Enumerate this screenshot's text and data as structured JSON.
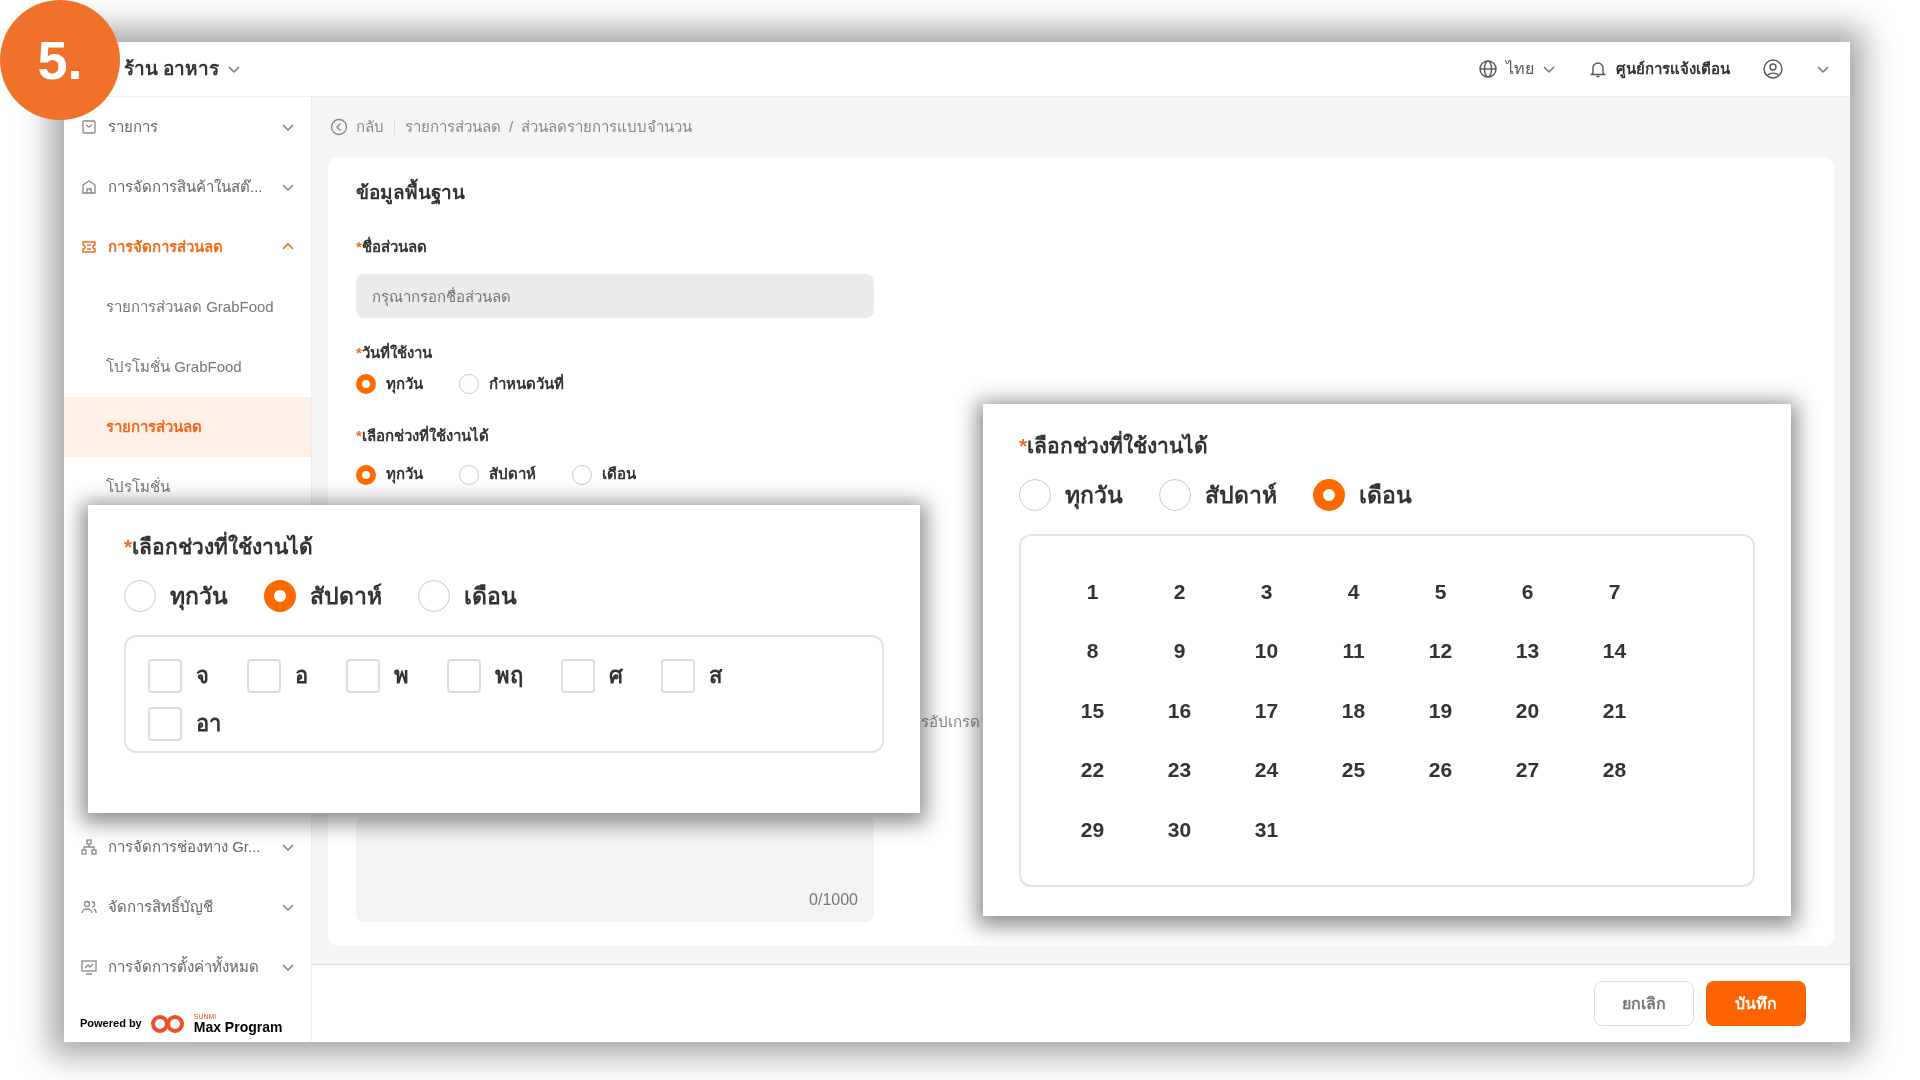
{
  "step_badge": "5.",
  "header": {
    "store": "ร้าน อาหาร",
    "language": "ไทย",
    "notifications": "ศูนย์การแจ้งเตือน"
  },
  "sidebar": {
    "items": [
      {
        "label": "รายการ",
        "kind": "receipt",
        "expanded": false,
        "selected": false
      },
      {
        "label": "การจัดการสินค้าในสต๊...",
        "kind": "store",
        "expanded": false,
        "selected": false
      },
      {
        "label": "การจัดการส่วนลด",
        "kind": "ticket",
        "expanded": true,
        "selected": true,
        "children": [
          {
            "label": "รายการส่วนลด GrabFood",
            "selected": false
          },
          {
            "label": "โปรโมชั่น GrabFood",
            "selected": false
          },
          {
            "label": "รายการส่วนลด",
            "selected": true
          },
          {
            "label": "โปรโมชั่น",
            "selected": false
          }
        ]
      },
      {
        "label": "การจัดการช่องทาง Gr...",
        "kind": "network",
        "expanded": false,
        "selected": false
      },
      {
        "label": "จัดการสิทธิ์บัญชี",
        "kind": "users",
        "expanded": false,
        "selected": false
      },
      {
        "label": "การจัดการตั้งค่าทั้งหมด",
        "kind": "monitor",
        "expanded": false,
        "selected": false
      }
    ],
    "powered_by": "Powered by",
    "brand_small": "SUNMI",
    "brand": "Max Program"
  },
  "breadcrumb": {
    "back": "กลับ",
    "separator": "/",
    "items": [
      "รายการส่วนลด",
      "ส่วนลดรายการแบบจำนวน"
    ]
  },
  "form": {
    "title": "ข้อมูลพื้นฐาน",
    "required_mark": "*",
    "name_label": "ชื่อส่วนลด",
    "name_placeholder": "กรุณากรอกชื่อส่วนลด",
    "date_label": "วันที่ใช้งาน",
    "date_options": [
      {
        "label": "ทุกวัน",
        "selected": true
      },
      {
        "label": "กำหนดวันที่",
        "selected": false
      }
    ],
    "range_label": "เลือกช่วงที่ใช้งานได้",
    "range_options": [
      {
        "label": "ทุกวัน",
        "selected": true
      },
      {
        "label": "สัปดาห์",
        "selected": false
      },
      {
        "label": "เดือน",
        "selected": false
      }
    ],
    "partial_text": "รอัปเกรด",
    "counter": "0/1000"
  },
  "footer": {
    "buttons": [
      {
        "label": "ยกเลิก",
        "kind": "secondary"
      },
      {
        "label": "บันทึก",
        "kind": "primary"
      }
    ]
  },
  "callout_week": {
    "required_mark": "*",
    "label": "เลือกช่วงที่ใช้งานได้",
    "options": [
      {
        "label": "ทุกวัน",
        "selected": false
      },
      {
        "label": "สัปดาห์",
        "selected": true
      },
      {
        "label": "เดือน",
        "selected": false
      }
    ],
    "days": [
      {
        "label": "จ",
        "checked": false
      },
      {
        "label": "อ",
        "checked": false
      },
      {
        "label": "พ",
        "checked": false
      },
      {
        "label": "พฤ",
        "checked": false
      },
      {
        "label": "ศ",
        "checked": false
      },
      {
        "label": "ส",
        "checked": false
      },
      {
        "label": "อา",
        "checked": false
      }
    ]
  },
  "callout_month": {
    "required_mark": "*",
    "label": "เลือกช่วงที่ใช้งานได้",
    "options": [
      {
        "label": "ทุกวัน",
        "selected": false
      },
      {
        "label": "สัปดาห์",
        "selected": false
      },
      {
        "label": "เดือน",
        "selected": true
      }
    ],
    "days": [
      "1",
      "2",
      "3",
      "4",
      "5",
      "6",
      "7",
      "8",
      "9",
      "10",
      "11",
      "12",
      "13",
      "14",
      "15",
      "16",
      "17",
      "18",
      "19",
      "20",
      "21",
      "22",
      "23",
      "24",
      "25",
      "26",
      "27",
      "28",
      "29",
      "30",
      "31"
    ]
  }
}
